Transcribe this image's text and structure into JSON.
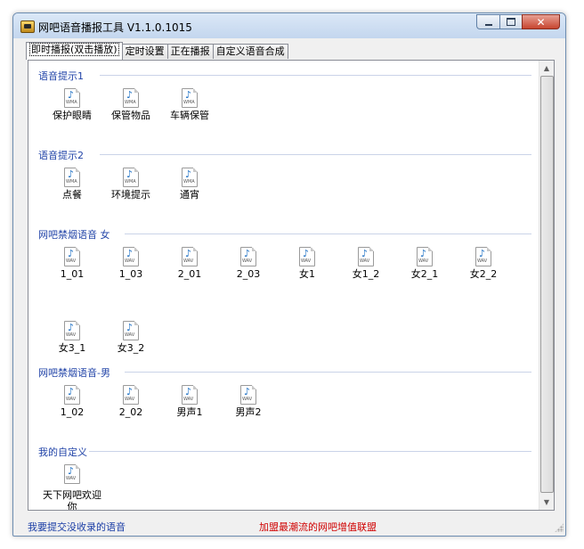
{
  "window": {
    "title": "网吧语音播报工具 V1.1.0.1015"
  },
  "tabs": [
    {
      "label": "即时播报(双击播放)",
      "active": true
    },
    {
      "label": "定时设置",
      "active": false
    },
    {
      "label": "正在播报",
      "active": false
    },
    {
      "label": "自定义语音合成",
      "active": false
    }
  ],
  "groups": [
    {
      "title": "语音提示1",
      "items": [
        {
          "label": "保护眼睛",
          "type": "WMA"
        },
        {
          "label": "保管物品",
          "type": "WMA"
        },
        {
          "label": "车辆保管",
          "type": "WMA"
        }
      ]
    },
    {
      "title": "语音提示2",
      "items": [
        {
          "label": "点餐",
          "type": "WMA"
        },
        {
          "label": "环境提示",
          "type": "WMA"
        },
        {
          "label": "通宵",
          "type": "WMA"
        }
      ]
    },
    {
      "title": "网吧禁烟语音 女",
      "items": [
        {
          "label": "1_01",
          "type": "WAV"
        },
        {
          "label": "1_03",
          "type": "WAV"
        },
        {
          "label": "2_01",
          "type": "WAV"
        },
        {
          "label": "2_03",
          "type": "WAV"
        },
        {
          "label": "女1",
          "type": "WAV"
        },
        {
          "label": "女1_2",
          "type": "WAV"
        },
        {
          "label": "女2_1",
          "type": "WAV"
        },
        {
          "label": "女2_2",
          "type": "WAV"
        },
        {
          "label": "女3_1",
          "type": "WAV"
        },
        {
          "label": "女3_2",
          "type": "WAV"
        }
      ]
    },
    {
      "title": "网吧禁烟语音-男",
      "items": [
        {
          "label": "1_02",
          "type": "WAV"
        },
        {
          "label": "2_02",
          "type": "WAV"
        },
        {
          "label": "男声1",
          "type": "WAV"
        },
        {
          "label": "男声2",
          "type": "WAV"
        }
      ]
    },
    {
      "title": "我的自定义",
      "items": [
        {
          "label": "天下网吧欢迎你",
          "type": "WAV"
        }
      ]
    }
  ],
  "status": {
    "left_link": "我要提交没收录的语音",
    "right_link": "加盟最潮流的网吧增值联盟"
  },
  "icons": {
    "file_icon": "audio-file-icon",
    "note_glyph": "♪"
  },
  "colors": {
    "group_title": "#2244a8",
    "status_left": "#1b3ea6",
    "status_right": "#d00000",
    "note": "#1c6fc4"
  }
}
